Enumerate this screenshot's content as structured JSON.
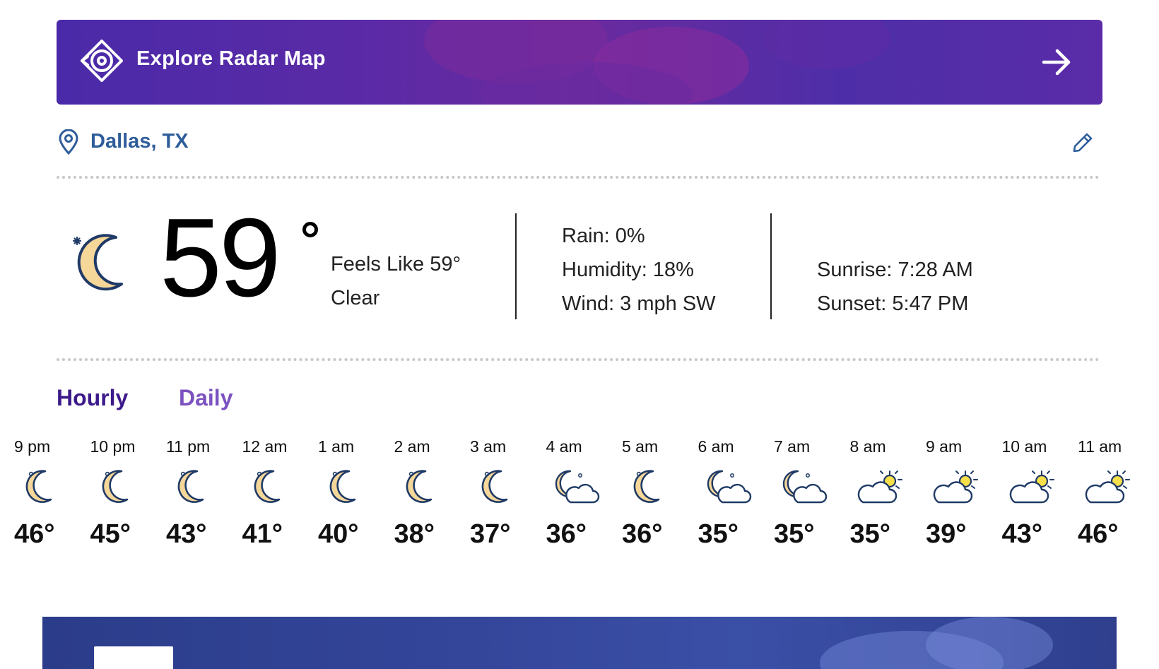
{
  "radar": {
    "label": "Explore Radar Map",
    "icon": "radar-target-icon",
    "arrow_icon": "arrow-right-icon"
  },
  "location": {
    "name": "Dallas, TX",
    "icon": "location-pin-icon",
    "edit_icon": "pencil-icon"
  },
  "current": {
    "icon": "clear-night-moon-icon",
    "temperature": "59",
    "feels_like": "Feels Like 59°",
    "condition": "Clear",
    "rain": "Rain: 0%",
    "humidity": "Humidity: 18%",
    "wind": "Wind: 3 mph SW",
    "sunrise": "Sunrise: 7:28 AM",
    "sunset": "Sunset: 5:47 PM"
  },
  "tabs": {
    "hourly": "Hourly",
    "daily": "Daily",
    "active": "hourly"
  },
  "hourly": [
    {
      "time": "9 pm",
      "temp": "46°",
      "icon": "moon"
    },
    {
      "time": "10 pm",
      "temp": "45°",
      "icon": "moon"
    },
    {
      "time": "11 pm",
      "temp": "43°",
      "icon": "moon"
    },
    {
      "time": "12 am",
      "temp": "41°",
      "icon": "moon"
    },
    {
      "time": "1 am",
      "temp": "40°",
      "icon": "moon"
    },
    {
      "time": "2 am",
      "temp": "38°",
      "icon": "moon"
    },
    {
      "time": "3 am",
      "temp": "37°",
      "icon": "moon"
    },
    {
      "time": "4 am",
      "temp": "36°",
      "icon": "moon-cloud"
    },
    {
      "time": "5 am",
      "temp": "36°",
      "icon": "moon"
    },
    {
      "time": "6 am",
      "temp": "35°",
      "icon": "moon-cloud"
    },
    {
      "time": "7 am",
      "temp": "35°",
      "icon": "moon-cloud"
    },
    {
      "time": "8 am",
      "temp": "35°",
      "icon": "sun-cloud"
    },
    {
      "time": "9 am",
      "temp": "39°",
      "icon": "sun-cloud"
    },
    {
      "time": "10 am",
      "temp": "43°",
      "icon": "sun-cloud"
    },
    {
      "time": "11 am",
      "temp": "46°",
      "icon": "sun-cloud"
    }
  ],
  "colors": {
    "radar_banner": "#5b2aa6",
    "location_text": "#2e5d9a",
    "hourly_tab": "#3c1a8a",
    "daily_tab": "#7b52c0",
    "moon_fill": "#f6d79a",
    "icon_stroke": "#1f3a66"
  }
}
